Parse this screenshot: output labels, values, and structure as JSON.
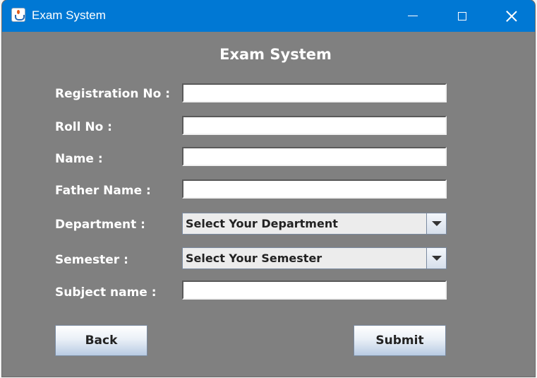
{
  "window": {
    "title": "Exam System"
  },
  "form": {
    "title": "Exam System",
    "fields": [
      {
        "label": "Registration No :",
        "value": ""
      },
      {
        "label": "Roll No :",
        "value": ""
      },
      {
        "label": "Name :",
        "value": ""
      },
      {
        "label": "Father Name :",
        "value": ""
      },
      {
        "label": "Department :",
        "selected": "Select Your Department"
      },
      {
        "label": "Semester :",
        "selected": "Select Your Semester"
      },
      {
        "label": "Subject name :",
        "value": ""
      }
    ]
  },
  "buttons": {
    "back": "Back",
    "submit": "Submit"
  },
  "icons": {
    "app": "java-cup-icon",
    "minimize": "minimize-icon",
    "maximize": "maximize-icon",
    "close": "close-icon"
  },
  "colors": {
    "titlebar": "#0078d4",
    "panel": "#808080"
  }
}
